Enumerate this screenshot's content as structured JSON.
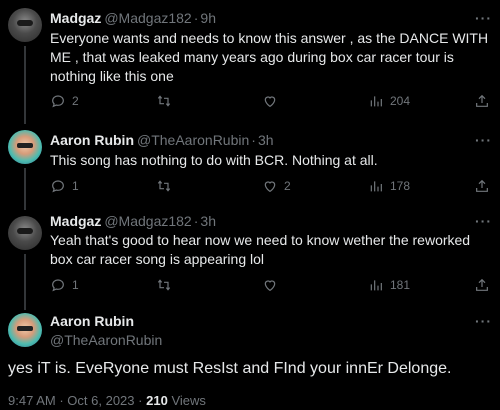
{
  "replies": [
    {
      "name": "Madgaz",
      "handle": "@Madgaz182",
      "sep": "·",
      "time": "9h",
      "text": "Everyone wants and needs to know this answer , as the DANCE WITH ME , that was leaked many years ago during box car racer tour is nothing like this one",
      "replies_count": "2",
      "retweets_count": "",
      "likes_count": "",
      "views_count": "204"
    },
    {
      "name": "Aaron Rubin",
      "handle": "@TheAaronRubin",
      "sep": "·",
      "time": "3h",
      "text": "This song has nothing to do with BCR. Nothing at all.",
      "replies_count": "1",
      "retweets_count": "",
      "likes_count": "2",
      "views_count": "178"
    },
    {
      "name": "Madgaz",
      "handle": "@Madgaz182",
      "sep": "·",
      "time": "3h",
      "text": "Yeah that's good to hear now we need to know wether the reworked box car racer song is appearing lol",
      "replies_count": "1",
      "retweets_count": "",
      "likes_count": "",
      "views_count": "181"
    }
  ],
  "main_tweet": {
    "name": "Aaron Rubin",
    "handle": "@TheAaronRubin",
    "text": "yes iT is. EveRyone must ResIst and FInd your innEr Delonge.",
    "time": "9:47 AM",
    "sep": "·",
    "date": "Oct 6, 2023",
    "sep2": "·",
    "views": "210",
    "views_label": "Views"
  },
  "more_label": "···",
  "colors": {
    "background": "#000000",
    "text": "#e7e9ea",
    "muted": "#71767b",
    "line": "#333639"
  },
  "icons": [
    "reply-icon",
    "retweet-icon",
    "like-icon",
    "views-icon",
    "share-icon"
  ]
}
